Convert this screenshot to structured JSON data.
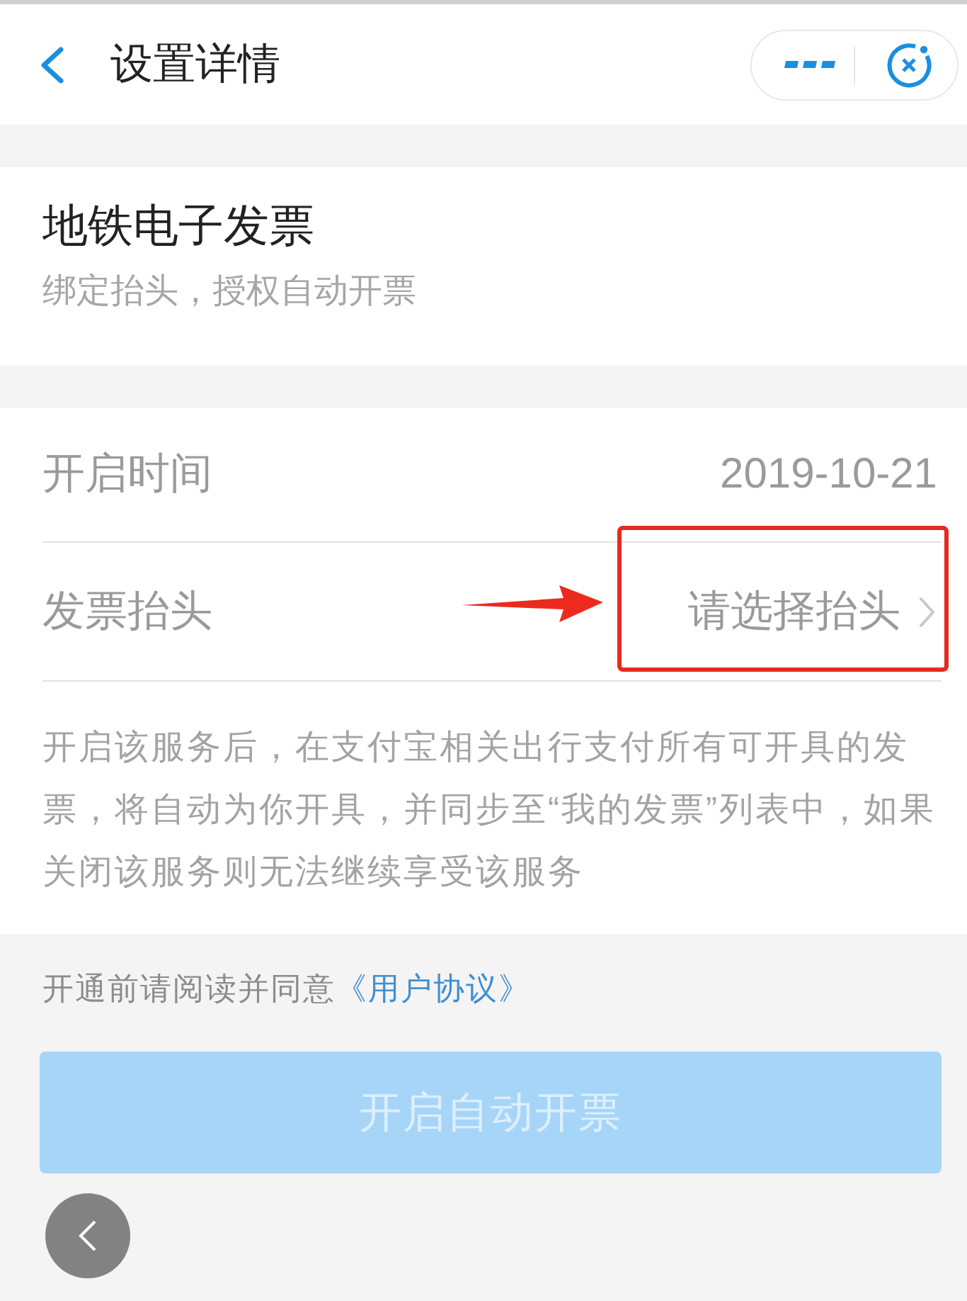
{
  "header": {
    "title": "设置详情"
  },
  "service": {
    "title": "地铁电子发票",
    "subtitle": "绑定抬头，授权自动开票"
  },
  "rows": [
    {
      "kind": "text",
      "label": "开启时间",
      "value": "2019-10-21",
      "annotated": false
    },
    {
      "kind": "select",
      "label": "发票抬头",
      "value": "请选择抬头",
      "annotated": true
    }
  ],
  "description": "开启该服务后，在支付宝相关出行支付所有可开具的发票，将自动为你开具，并同步至“我的发票”列表中，如果关闭该服务则无法继续享受该服务",
  "agreement": {
    "text": "开通前请阅读并同意",
    "link": "《用户协议》"
  },
  "submit": {
    "label": "开启自动开票",
    "disabled": true
  }
}
